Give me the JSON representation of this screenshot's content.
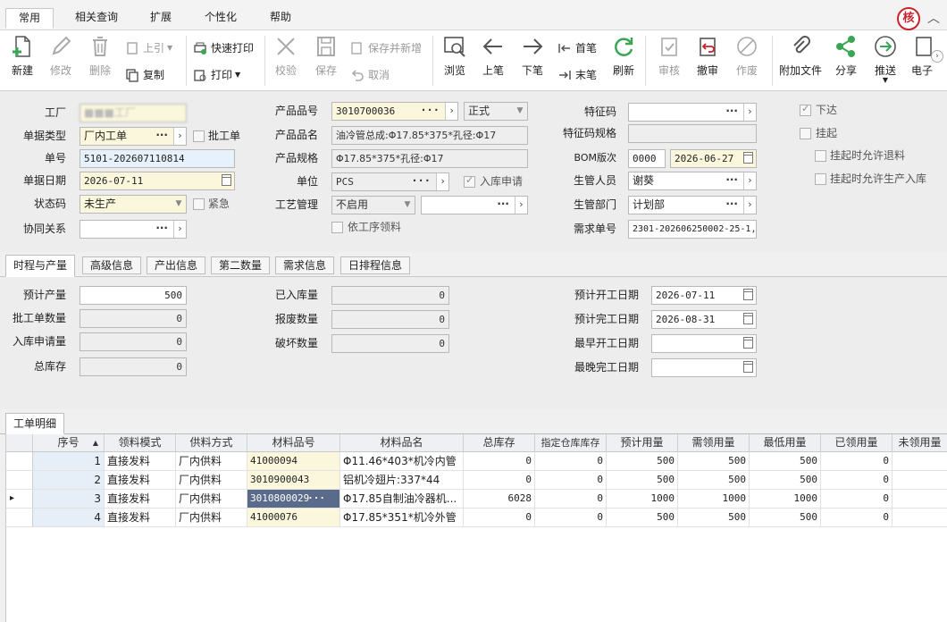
{
  "menu": {
    "tabs": [
      "常用",
      "相关查询",
      "扩展",
      "个性化",
      "帮助"
    ],
    "active": 0,
    "badge": "核"
  },
  "toolbar": {
    "new": "新建",
    "edit": "修改",
    "delete": "删除",
    "prev_ref": "上引",
    "copy": "复制",
    "quick_print": "快速打印",
    "print": "打印",
    "check": "校验",
    "save": "保存",
    "save_new": "保存并新增",
    "cancel": "取消",
    "browse": "浏览",
    "prev": "上笔",
    "next": "下笔",
    "first": "首笔",
    "last": "末笔",
    "refresh": "刷新",
    "audit": "审核",
    "unaudit": "撤审",
    "void": "作废",
    "attach": "附加文件",
    "share": "分享",
    "push": "推送",
    "more": "电子"
  },
  "form": {
    "factory_label": "工厂",
    "factory_value": "■■■工厂",
    "doc_type_label": "单据类型",
    "doc_type_value": "厂内工单",
    "batch_label": "批工单",
    "doc_no_label": "单号",
    "doc_no_value": "5101-202607110814",
    "doc_date_label": "单据日期",
    "doc_date_value": "2026-07-11",
    "status_label": "状态码",
    "status_value": "未生产",
    "urgent_label": "紧急",
    "collab_label": "协同关系",
    "collab_value": "",
    "product_no_label": "产品品号",
    "product_no_value": "3010700036",
    "product_form_value": "正式",
    "product_name_label": "产品品名",
    "product_name_value": "油冷管总成:Φ17.85*375*孔径:Φ17",
    "product_spec_label": "产品规格",
    "product_spec_value": "Φ17.85*375*孔径:Φ17",
    "unit_label": "单位",
    "unit_value": "PCS",
    "stock_apply_label": "入库申请",
    "process_label": "工艺管理",
    "process_value": "不启用",
    "by_process_label": "依工序领料",
    "feature_label": "特征码",
    "feature_value": "",
    "feature_spec_label": "特征码规格",
    "feature_spec_value": "",
    "bom_label": "BOM版次",
    "bom_value": "0000",
    "bom_date": "2026-06-27",
    "mgr_label": "生管人员",
    "mgr_value": "谢葵",
    "dept_label": "生管部门",
    "dept_value": "计划部",
    "demand_label": "需求单号",
    "demand_value": "2301-202606250002-25-1,",
    "issued_label": "下达",
    "hold_label": "挂起",
    "hold_return_label": "挂起时允许退料",
    "hold_stock_label": "挂起时允许生产入库"
  },
  "subtabs": [
    "时程与产量",
    "高级信息",
    "产出信息",
    "第二数量",
    "需求信息",
    "日排程信息"
  ],
  "qty": {
    "planned_label": "预计产量",
    "planned_value": "500",
    "batch_qty_label": "批工单数量",
    "batch_qty_value": "0",
    "apply_qty_label": "入库申请量",
    "apply_qty_value": "0",
    "total_stock_label": "总库存",
    "total_stock_value": "0",
    "stocked_label": "已入库量",
    "stocked_value": "0",
    "scrap_label": "报废数量",
    "scrap_value": "0",
    "broken_label": "破坏数量",
    "broken_value": "0",
    "start_label": "预计开工日期",
    "start_value": "2026-07-11",
    "end_label": "预计完工日期",
    "end_value": "2026-08-31",
    "earliest_label": "最早开工日期",
    "earliest_value": "",
    "latest_label": "最晚完工日期",
    "latest_value": ""
  },
  "grid": {
    "tab": "工单明细",
    "headers": [
      "序号",
      "领料模式",
      "供料方式",
      "材料品号",
      "材料品名",
      "总库存",
      "指定仓库库存",
      "预计用量",
      "需领用量",
      "最低用量",
      "已领用量",
      "未领用量"
    ],
    "rows": [
      [
        "1",
        "直接发料",
        "厂内供料",
        "41000094",
        "Φ11.46*403*机冷内管",
        "0",
        "0",
        "500",
        "500",
        "500",
        "0",
        ""
      ],
      [
        "2",
        "直接发料",
        "厂内供料",
        "3010900043",
        "铝机冷翅片:337*44",
        "0",
        "0",
        "500",
        "500",
        "500",
        "0",
        ""
      ],
      [
        "3",
        "直接发料",
        "厂内供料",
        "3010800029",
        "Φ17.85自制油冷器机...",
        "6028",
        "0",
        "1000",
        "1000",
        "1000",
        "0",
        ""
      ],
      [
        "4",
        "直接发料",
        "厂内供料",
        "41000076",
        "Φ17.85*351*机冷外管",
        "0",
        "0",
        "500",
        "500",
        "500",
        "0",
        ""
      ]
    ]
  },
  "colors": {
    "accent": "#c8232c",
    "field_yellow": "#fbf7dc",
    "field_blue": "#e7f1fb",
    "selected": "#5a6a8a",
    "green": "#3aa655"
  }
}
